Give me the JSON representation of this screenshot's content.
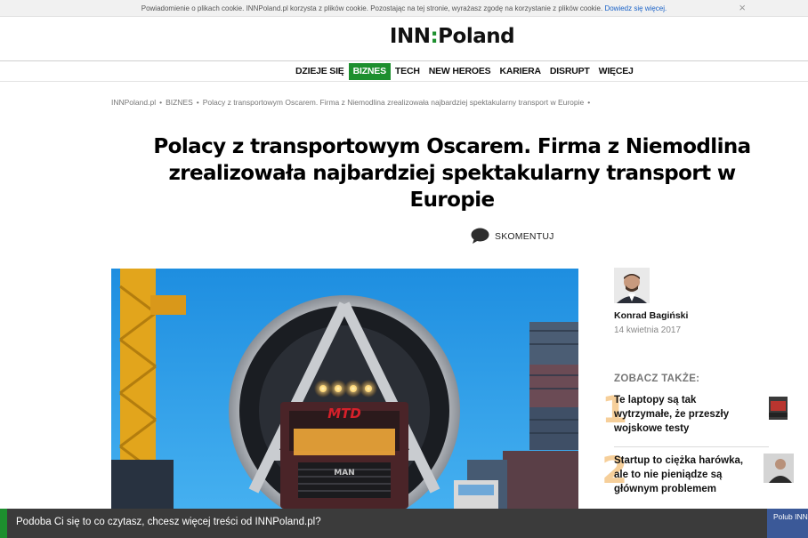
{
  "cookie": {
    "text": "Powiadomienie o plikach cookie. INNPoland.pl korzysta z plików cookie. Pozostając na tej stronie, wyrażasz zgodę na korzystanie z plików cookie.",
    "link": "Dowiedz się więcej.",
    "close": "×"
  },
  "logo": {
    "left": "INN",
    "colon": ":",
    "right": "Poland"
  },
  "nav": [
    {
      "label": "DZIEJE SIĘ",
      "active": false
    },
    {
      "label": "BIZNES",
      "active": true
    },
    {
      "label": "TECH",
      "active": false
    },
    {
      "label": "NEW HEROES",
      "active": false
    },
    {
      "label": "KARIERA",
      "active": false
    },
    {
      "label": "DISRUPT",
      "active": false
    },
    {
      "label": "WIĘCEJ",
      "active": false
    }
  ],
  "breadcrumb": {
    "items": [
      "INNPoland.pl",
      "BIZNES",
      "Polacy z transportowym Oscarem. Firma z Niemodlina zrealizowała najbardziej spektakularny transport w Europie"
    ],
    "separator": "•"
  },
  "article": {
    "title": "Polacy z transportowym Oscarem. Firma z Niemodlina zrealizowała najbardziej spektakularny transport w Europie",
    "comment_label": "SKOMENTUJ",
    "truck_brand": "MTD",
    "truck_make": "MAN"
  },
  "author": {
    "name": "Konrad Bagiński",
    "date": "14 kwietnia 2017"
  },
  "related": {
    "heading": "ZOBACZ TAKŻE:",
    "items": [
      {
        "num": "1",
        "title": "Te laptopy są tak wytrzymałe, że przeszły wojskowe testy"
      },
      {
        "num": "2",
        "title": "Startup to ciężka harówka, ale to nie pieniądze są głównym problemem"
      }
    ]
  },
  "bottom": {
    "text": "Podoba Ci się to co czytasz, chcesz więcej treści od INNPoland.pl?",
    "like": "Polub INNPoland"
  },
  "colors": {
    "accent": "#1d8f2e",
    "facebook": "#3b5998",
    "bottom_bar": "#3b3b3b"
  }
}
